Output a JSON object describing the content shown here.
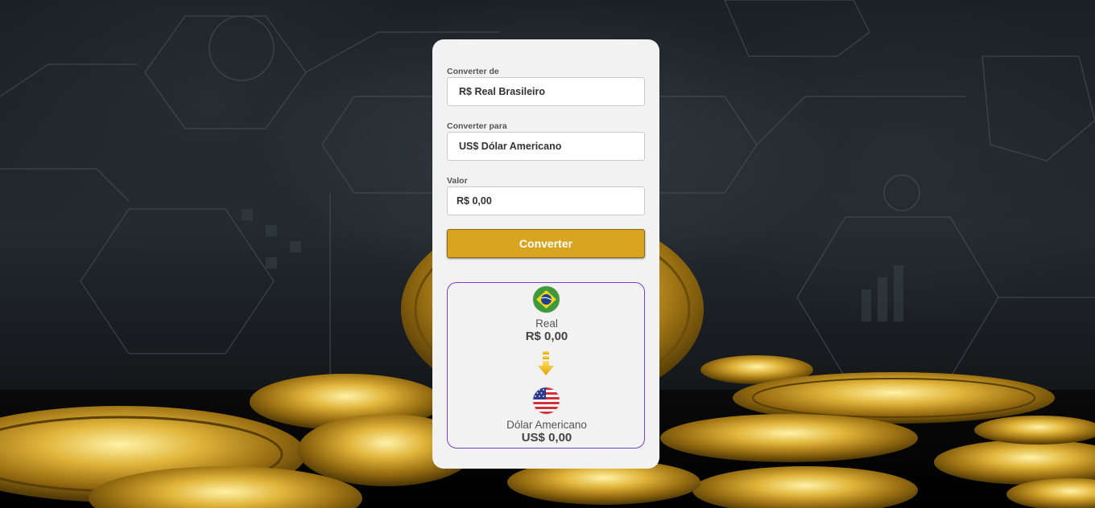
{
  "form": {
    "from_label": "Converter de",
    "from_value": "R$ Real Brasileiro",
    "to_label": "Converter para",
    "to_value": "US$ Dólar Americano",
    "amount_label": "Valor",
    "amount_value": "R$ 0,00",
    "convert_button": "Converter"
  },
  "result": {
    "from": {
      "name": "Real",
      "value": "R$ 0,00",
      "flag_icon": "brazil-flag-icon"
    },
    "to": {
      "name": "Dólar Americano",
      "value": "US$ 0,00",
      "flag_icon": "usa-flag-icon"
    },
    "arrow_icon": "arrow-down-icon"
  },
  "colors": {
    "button": "#d9a521",
    "result_border": "#7a3bd1",
    "card_bg": "#f2f2f2"
  }
}
